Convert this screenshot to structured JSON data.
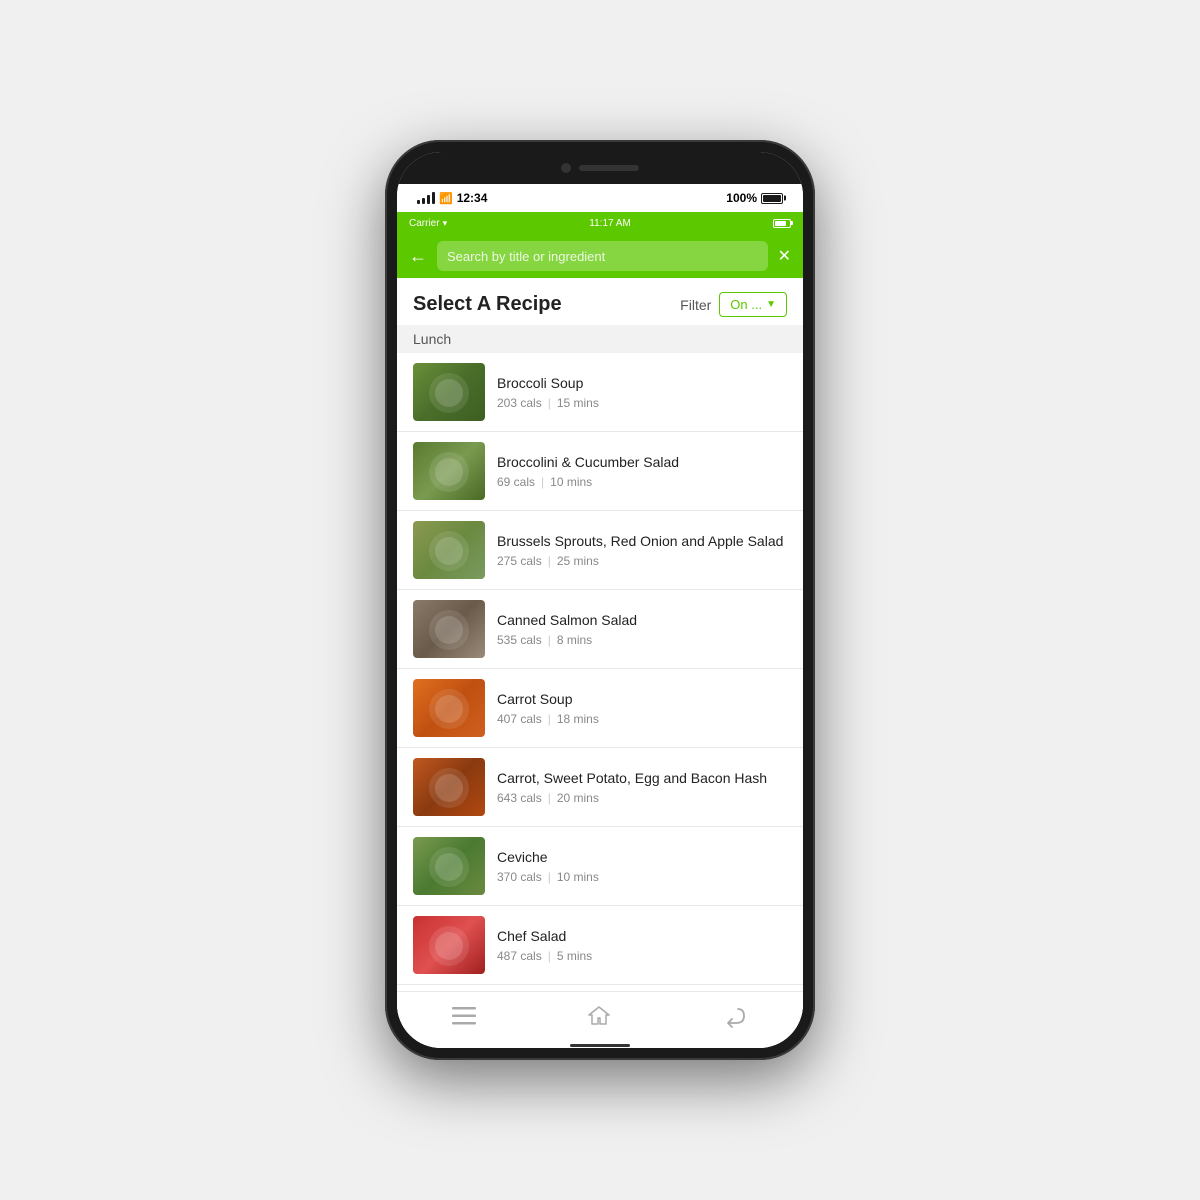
{
  "phone": {
    "os_time": "12:34",
    "os_battery": "100%",
    "app_carrier": "Carrier",
    "app_time": "11:17 AM"
  },
  "search": {
    "placeholder": "Search by title or ingredient"
  },
  "page": {
    "title": "Select A Recipe",
    "filter_label": "Filter",
    "filter_value": "On ..."
  },
  "section": {
    "label": "Lunch"
  },
  "recipes": [
    {
      "name": "Broccoli Soup",
      "cals": "203 cals",
      "time": "15 mins",
      "thumb_class": "thumb-broccoli"
    },
    {
      "name": "Broccolini & Cucumber Salad",
      "cals": "69 cals",
      "time": "10 mins",
      "thumb_class": "thumb-broccolini"
    },
    {
      "name": "Brussels Sprouts, Red Onion and Apple Salad",
      "cals": "275 cals",
      "time": "25 mins",
      "thumb_class": "thumb-brussels"
    },
    {
      "name": "Canned Salmon Salad",
      "cals": "535 cals",
      "time": "8 mins",
      "thumb_class": "thumb-salmon"
    },
    {
      "name": "Carrot Soup",
      "cals": "407 cals",
      "time": "18 mins",
      "thumb_class": "thumb-carrot"
    },
    {
      "name": "Carrot, Sweet Potato, Egg and Bacon Hash",
      "cals": "643 cals",
      "time": "20 mins",
      "thumb_class": "thumb-carrot-hash"
    },
    {
      "name": "Ceviche",
      "cals": "370 cals",
      "time": "10 mins",
      "thumb_class": "thumb-ceviche"
    },
    {
      "name": "Chef Salad",
      "cals": "487 cals",
      "time": "5 mins",
      "thumb_class": "thumb-chef"
    }
  ],
  "nav": {
    "menu_icon": "☰",
    "home_icon": "⌂",
    "back_icon": "↩"
  }
}
